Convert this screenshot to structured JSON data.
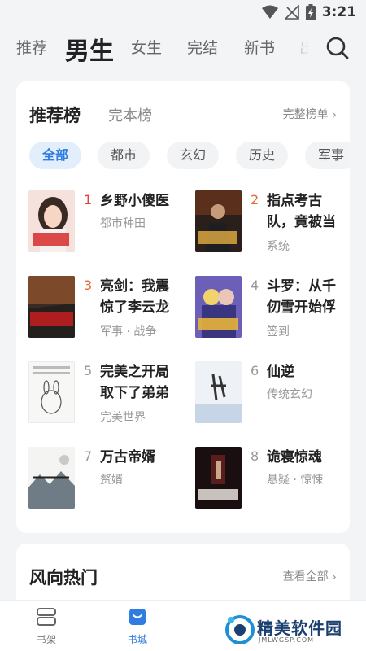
{
  "status_bar": {
    "time": "3:21"
  },
  "top_tabs": [
    "推荐",
    "男生",
    "女生",
    "完结",
    "新书",
    "出"
  ],
  "active_top_tab": "男生",
  "ranking_card": {
    "title": "推荐榜",
    "subtab": "完本榜",
    "more_label": "完整榜单",
    "chips": [
      "全部",
      "都市",
      "玄幻",
      "历史",
      "军事"
    ],
    "active_chip": "全部",
    "books": [
      {
        "rank": "1",
        "title": "乡野小傻医",
        "tag": "都市种田",
        "cover_icon": "cover-girl-portrait"
      },
      {
        "rank": "2",
        "title": "指点考古队，竟被当",
        "tag": "系统",
        "cover_icon": "cover-armored-warrior"
      },
      {
        "rank": "3",
        "title": "亮剑：我震惊了李云龙",
        "tag": "军事 · 战争",
        "cover_icon": "cover-battlefield"
      },
      {
        "rank": "4",
        "title": "斗罗：从千仞雪开始俘",
        "tag": "签到",
        "cover_icon": "cover-anime-characters"
      },
      {
        "rank": "5",
        "title": "完美之开局取下了弟弟",
        "tag": "完美世界",
        "cover_icon": "cover-cartoon-rabbit"
      },
      {
        "rank": "6",
        "title": "仙逆",
        "tag": "传统玄幻",
        "cover_icon": "cover-calligraphy"
      },
      {
        "rank": "7",
        "title": "万古帝婿",
        "tag": "赘婿",
        "cover_icon": "cover-ink-landscape"
      },
      {
        "rank": "8",
        "title": "诡寝惊魂",
        "tag": "悬疑 · 惊悚",
        "cover_icon": "cover-horror-corridor"
      }
    ]
  },
  "trend_card": {
    "title": "风向热门",
    "more_label": "查看全部"
  },
  "bottom_tabs": [
    {
      "label": "书架",
      "icon": "bookshelf-icon"
    },
    {
      "label": "书城",
      "icon": "bookstore-icon"
    }
  ],
  "watermark": {
    "text": "精美软件园",
    "url": "JMLWGSP.COM"
  },
  "colors": {
    "accent": "#2f7de1",
    "rank_first": "#e2423b",
    "rank_top": "#e56a2d",
    "chip_active_bg": "#e3eefc"
  }
}
